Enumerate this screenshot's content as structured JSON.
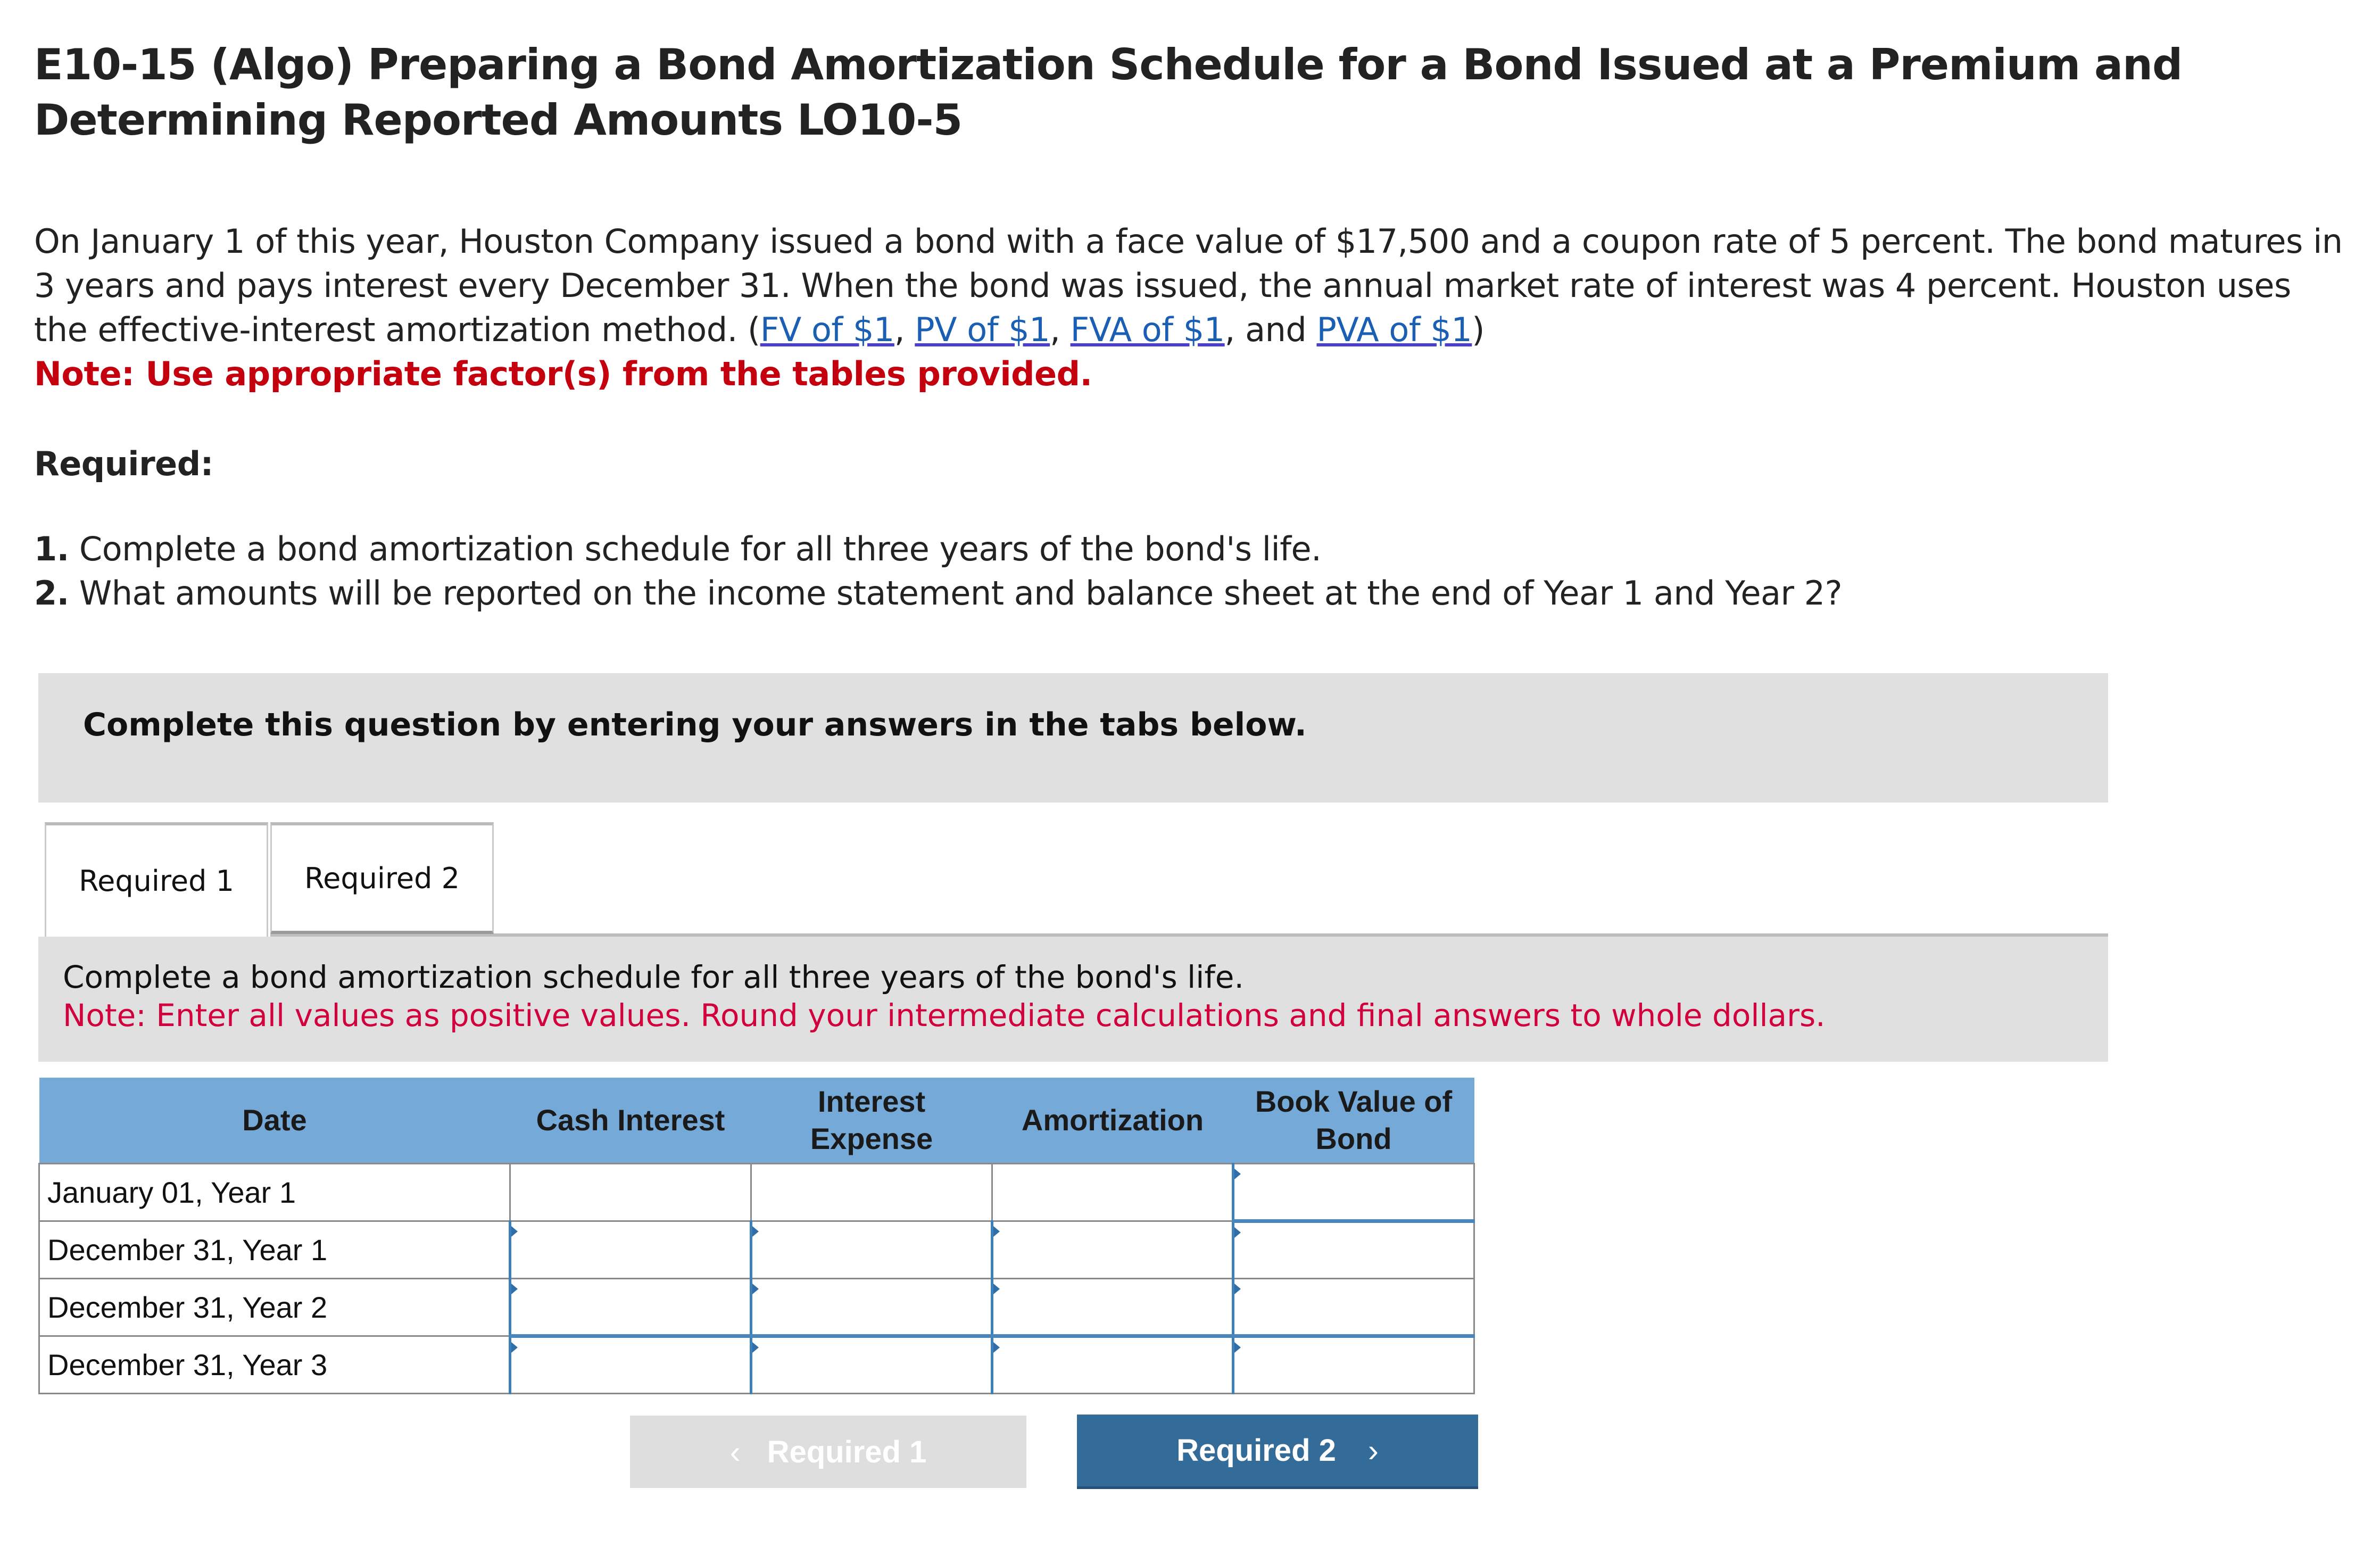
{
  "header": {
    "title": "E10-15 (Algo) Preparing a Bond Amortization Schedule for a Bond Issued at a Premium and Determining Reported Amounts LO10-5"
  },
  "problem": {
    "text": "On January 1 of this year, Houston Company issued a bond with a face value of $17,500 and a coupon rate of 5 percent. The bond matures in 3 years and pays interest every December 31. When the bond was issued, the annual market rate of interest was 4 percent. Houston uses the effective-interest amortization method. (",
    "links": [
      "FV of $1",
      "PV of $1",
      "FVA of $1",
      "PVA of $1"
    ],
    "sep1": ", ",
    "sep2": ", ",
    "sep3": ", and ",
    "close": ")",
    "note": "Note: Use appropriate factor(s) from the tables provided."
  },
  "required": {
    "label": "Required:",
    "items": [
      {
        "num": "1.",
        "text": " Complete a bond amortization schedule for all three years of the bond's life."
      },
      {
        "num": "2.",
        "text": " What amounts will be reported on the income statement and balance sheet at the end of Year 1 and Year 2?"
      }
    ]
  },
  "instruction_box": {
    "text": "Complete this question by entering your answers in the tabs below."
  },
  "tabs": [
    {
      "label": "Required 1",
      "active": true
    },
    {
      "label": "Required 2",
      "active": false
    }
  ],
  "tab_content": {
    "instruction": "Complete a bond amortization schedule for all three years of the bond's life.",
    "note": "Note: Enter all values as positive values. Round your intermediate calculations and final answers to whole dollars."
  },
  "schedule": {
    "columns": [
      "Date",
      "Cash Interest",
      "Interest Expense",
      "Amortization",
      "Book Value of Bond"
    ],
    "rows": [
      {
        "date": "January 01, Year 1",
        "cash_interest": "",
        "interest_expense": "",
        "amortization": "",
        "book_value": ""
      },
      {
        "date": "December 31, Year 1",
        "cash_interest": "",
        "interest_expense": "",
        "amortization": "",
        "book_value": ""
      },
      {
        "date": "December 31, Year 2",
        "cash_interest": "",
        "interest_expense": "",
        "amortization": "",
        "book_value": ""
      },
      {
        "date": "December 31, Year 3",
        "cash_interest": "",
        "interest_expense": "",
        "amortization": "",
        "book_value": ""
      }
    ]
  },
  "navigation": {
    "prev_label": "Required 1",
    "prev_icon": "chevron-left-icon",
    "next_label": "Required 2",
    "next_icon": "chevron-right-icon",
    "prev_glyph": "‹",
    "next_glyph": "›"
  },
  "colors": {
    "table_header": "#74a9d8",
    "panel_gray": "#e0e0e0",
    "nav_button": "#336b99",
    "note_red": "#c4000e",
    "link_blue": "#1a5fb4"
  }
}
